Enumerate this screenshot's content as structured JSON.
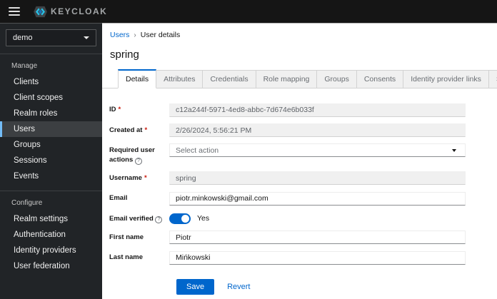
{
  "masthead": {
    "logo_text": "KEYCLOAK"
  },
  "sidebar": {
    "realm": "demo",
    "groups": [
      {
        "title": "Manage",
        "items": [
          "Clients",
          "Client scopes",
          "Realm roles",
          "Users",
          "Groups",
          "Sessions",
          "Events"
        ]
      },
      {
        "title": "Configure",
        "items": [
          "Realm settings",
          "Authentication",
          "Identity providers",
          "User federation"
        ]
      }
    ],
    "active_item": "Users"
  },
  "breadcrumb": {
    "parent": "Users",
    "current": "User details"
  },
  "page": {
    "title": "spring"
  },
  "tabs": [
    "Details",
    "Attributes",
    "Credentials",
    "Role mapping",
    "Groups",
    "Consents",
    "Identity provider links",
    "Sessions"
  ],
  "active_tab": "Details",
  "form": {
    "required_marker": "*",
    "id": {
      "label": "ID",
      "value": "c12a244f-5971-4ed8-abbc-7d674e6b033f"
    },
    "created_at": {
      "label": "Created at",
      "value": "2/26/2024, 5:56:21 PM"
    },
    "required_user_actions": {
      "label": "Required user actions",
      "placeholder": "Select action"
    },
    "username": {
      "label": "Username",
      "value": "spring"
    },
    "email": {
      "label": "Email",
      "value": "piotr.minkowski@gmail.com"
    },
    "email_verified": {
      "label": "Email verified",
      "state": "Yes"
    },
    "first_name": {
      "label": "First name",
      "value": "Piotr"
    },
    "last_name": {
      "label": "Last name",
      "value": "Mińkowski"
    }
  },
  "actions": {
    "save": "Save",
    "revert": "Revert"
  },
  "icons": {
    "help": "?",
    "breadcrumb_separator": "›"
  },
  "colors": {
    "primary": "#0066cc",
    "masthead_bg": "#151515",
    "sidebar_bg": "#212427",
    "active_nav_bg": "#3c3f42",
    "active_nav_border": "#73bcf7",
    "danger": "#c9190b",
    "tab_inactive_bg": "#f0f0f0",
    "disabled_input_bg": "#f0f0f0"
  }
}
